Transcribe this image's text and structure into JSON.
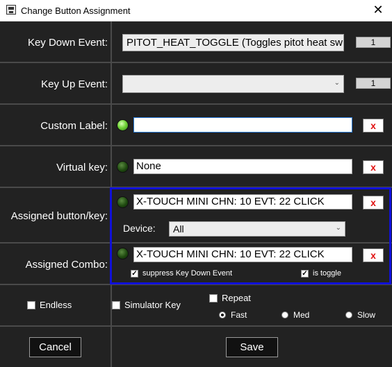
{
  "window": {
    "title": "Change Button Assignment",
    "close_glyph": "✕"
  },
  "rows": {
    "key_down": {
      "label": "Key Down Event:",
      "value": "PITOT_HEAT_TOGGLE (Toggles pitot heat switch)",
      "count": "1"
    },
    "key_up": {
      "label": "Key Up Event:",
      "value": "",
      "count": "1"
    },
    "custom_label": {
      "label": "Custom Label:",
      "value": "",
      "clear": "x"
    },
    "virtual_key": {
      "label": "Virtual key:",
      "value": "None",
      "clear": "x"
    },
    "assigned_button": {
      "label": "Assigned button/key:",
      "value": "X-TOUCH MINI CHN: 10 EVT: 22 CLICK",
      "clear": "x",
      "device_label": "Device:",
      "device_value": "All"
    },
    "assigned_combo": {
      "label": "Assigned Combo:",
      "value": "X-TOUCH MINI CHN: 10 EVT: 22 CLICK",
      "clear": "x",
      "suppress_label": "suppress Key Down Event",
      "suppress_checked": true,
      "toggle_label": "is toggle",
      "toggle_checked": true
    }
  },
  "options": {
    "endless": {
      "label": "Endless",
      "checked": false
    },
    "simulator_key": {
      "label": "Simulator Key",
      "checked": false
    },
    "repeat": {
      "label": "Repeat",
      "checked": false
    },
    "speeds": [
      {
        "label": "Fast",
        "selected": true
      },
      {
        "label": "Med",
        "selected": false
      },
      {
        "label": "Slow",
        "selected": false
      }
    ]
  },
  "buttons": {
    "cancel": "Cancel",
    "save": "Save"
  },
  "icons": {
    "chevron": "chevron-down-icon",
    "led_on": "green-led-on",
    "led_off": "green-led-off"
  },
  "colors": {
    "highlight_border": "#1010d8",
    "clear_x": "#e01010",
    "led_on": "#74d63a",
    "led_off": "#1f4a10"
  }
}
